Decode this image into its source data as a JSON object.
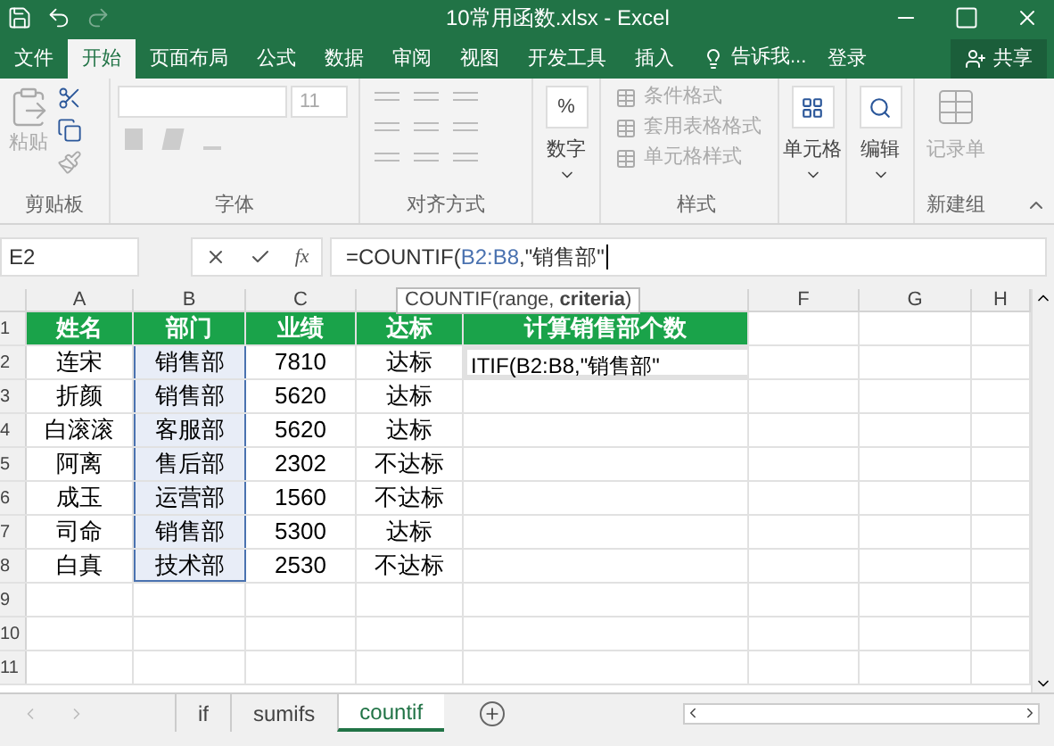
{
  "window": {
    "title": "10常用函数.xlsx - Excel"
  },
  "ribbon_tabs": [
    {
      "label": "文件",
      "selected": false
    },
    {
      "label": "开始",
      "selected": true
    },
    {
      "label": "页面布局",
      "selected": false
    },
    {
      "label": "公式",
      "selected": false
    },
    {
      "label": "数据",
      "selected": false
    },
    {
      "label": "审阅",
      "selected": false
    },
    {
      "label": "视图",
      "selected": false
    },
    {
      "label": "开发工具",
      "selected": false
    },
    {
      "label": "插入",
      "selected": false
    }
  ],
  "tell_me": "告诉我...",
  "sign_in": "登录",
  "share": "共享",
  "ribbon": {
    "paste": "粘贴",
    "font_size": "11",
    "number": "数字",
    "number_symbol": "%",
    "styles": [
      {
        "label": "条件格式"
      },
      {
        "label": "套用表格格式"
      },
      {
        "label": "单元格样式"
      }
    ],
    "cells": "单元格",
    "editing": "编辑",
    "form": "记录单",
    "groups": [
      "剪贴板",
      "字体",
      "对齐方式",
      "样式",
      "新建组"
    ]
  },
  "name_box": "E2",
  "formula": {
    "prefix": "=COUNTIF(",
    "range": "B2:B8",
    "suffix": ",\"销售部\""
  },
  "tooltip": {
    "text": "COUNTIF(range, ",
    "bold": "criteria",
    "close": ")"
  },
  "function_button": "fx",
  "columns": [
    "A",
    "B",
    "C",
    "F",
    "G",
    "H"
  ],
  "rows": [
    {
      "number": "1",
      "cells": [
        "姓名",
        "部门",
        "业绩",
        "达标",
        "计算销售部个数"
      ]
    },
    {
      "number": "2",
      "cells": [
        "连宋",
        "销售部",
        "7810",
        "达标",
        "ITIF(B2:B8,\"销售部\""
      ]
    },
    {
      "number": "3",
      "cells": [
        "折颜",
        "销售部",
        "5620",
        "达标",
        ""
      ]
    },
    {
      "number": "4",
      "cells": [
        "白滚滚",
        "客服部",
        "5620",
        "达标",
        ""
      ]
    },
    {
      "number": "5",
      "cells": [
        "阿离",
        "售后部",
        "2302",
        "不达标",
        ""
      ]
    },
    {
      "number": "6",
      "cells": [
        "成玉",
        "运营部",
        "1560",
        "不达标",
        ""
      ]
    },
    {
      "number": "7",
      "cells": [
        "司命",
        "销售部",
        "5300",
        "达标",
        ""
      ]
    },
    {
      "number": "8",
      "cells": [
        "白真",
        "技术部",
        "2530",
        "不达标",
        ""
      ]
    },
    {
      "number": "9",
      "cells": []
    },
    {
      "number": "10",
      "cells": []
    },
    {
      "number": "11",
      "cells": []
    }
  ],
  "sheets": [
    {
      "label": "if",
      "selected": false
    },
    {
      "label": "sumifs",
      "selected": false
    },
    {
      "label": "countif",
      "selected": true
    }
  ]
}
